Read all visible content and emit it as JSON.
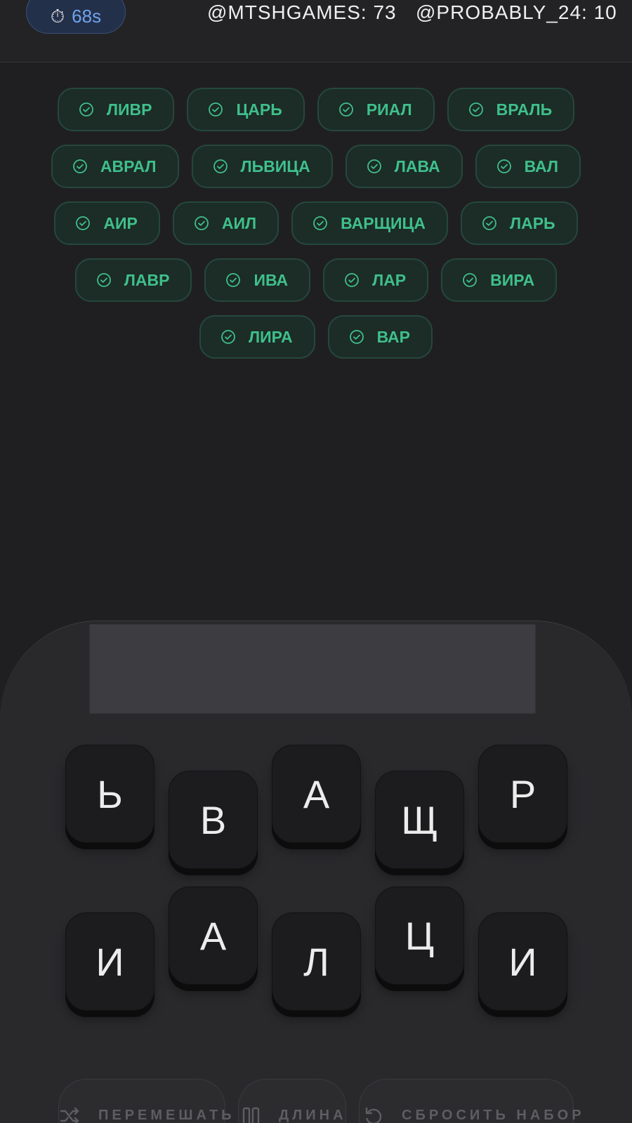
{
  "header": {
    "timer_icon": "⏱",
    "timer": "68s",
    "scores": [
      {
        "label": "@MTSHGAMES: 73"
      },
      {
        "label": "@PROBABLY_24: 10"
      }
    ]
  },
  "found_words": [
    [
      "ЛИВР",
      "ЦАРЬ",
      "РИАЛ",
      "ВРАЛЬ"
    ],
    [
      "АВРАЛ",
      "ЛЬВИЦА",
      "ЛАВА",
      "ВАЛ"
    ],
    [
      "АИР",
      "АИЛ",
      "ВАРЩИЦА",
      "ЛАРЬ"
    ],
    [
      "ЛАВР",
      "ИВА",
      "ЛАР",
      "ВИРА"
    ],
    [
      "ЛИРА",
      "ВАР"
    ]
  ],
  "letters": [
    "Ь",
    "В",
    "А",
    "Щ",
    "Р",
    "И",
    "А",
    "Л",
    "Ц",
    "И"
  ],
  "controls": {
    "shuffle": "ПЕРЕМЕШАТЬ",
    "length": "ДЛИНА",
    "reset": "СБРОСИТЬ НАБОР"
  },
  "colors": {
    "accent_green": "#3fbf8b",
    "timer_blue": "#6fa3ee",
    "background": "#1f1f21"
  },
  "icons": {
    "timer": "stopwatch-icon",
    "found_word": "check-circle-icon",
    "shuffle": "shuffle-icon",
    "length": "columns-icon",
    "reset": "undo-icon"
  }
}
